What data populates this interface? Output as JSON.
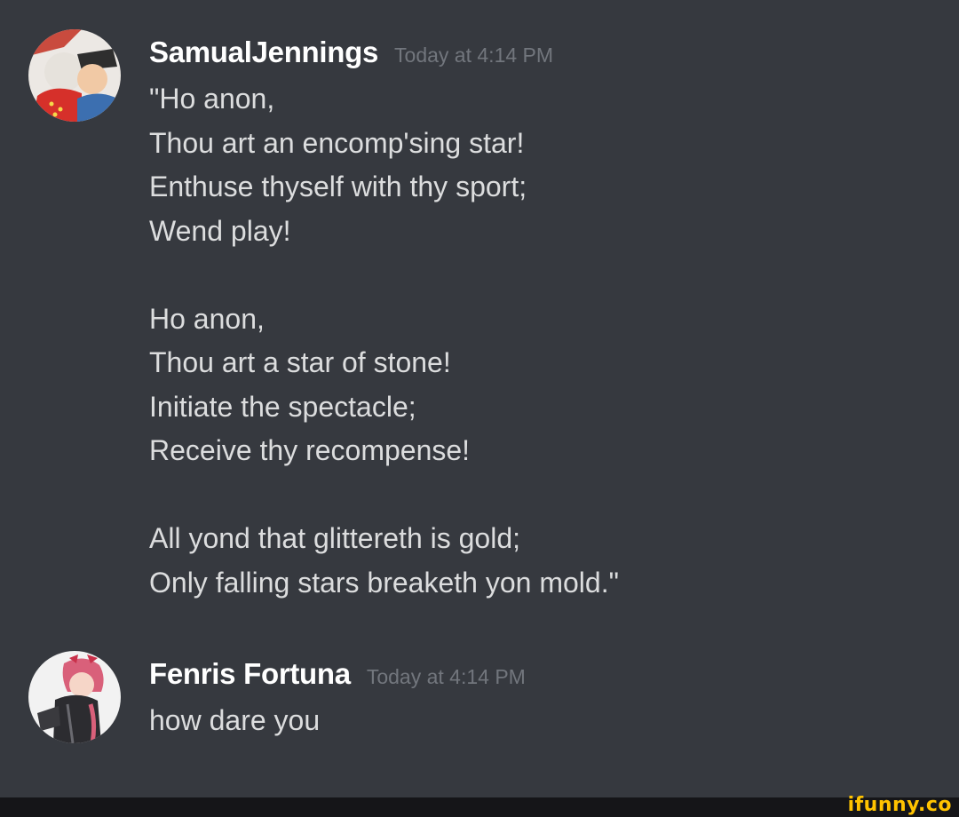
{
  "messages": [
    {
      "username": "SamualJennings",
      "timestamp": "Today at 4:14 PM",
      "lines": [
        "\"Ho anon,",
        "Thou art an encomp'sing star!",
        "Enthuse thyself with thy sport;",
        "Wend play!",
        "",
        "Ho anon,",
        "Thou art a star of stone!",
        "Initiate the spectacle;",
        "Receive thy recompense!",
        "",
        "All yond that glittereth is gold;",
        "Only falling stars breaketh yon mold.\""
      ]
    },
    {
      "username": "Fenris Fortuna",
      "timestamp": "Today at 4:14 PM",
      "lines": [
        "how dare you"
      ]
    }
  ],
  "watermark": "ifunny.co",
  "colors": {
    "background": "#36393f",
    "username": "#ffffff",
    "timestamp": "#72767d",
    "message_text": "#dcddde",
    "watermark": "#ffc300"
  }
}
